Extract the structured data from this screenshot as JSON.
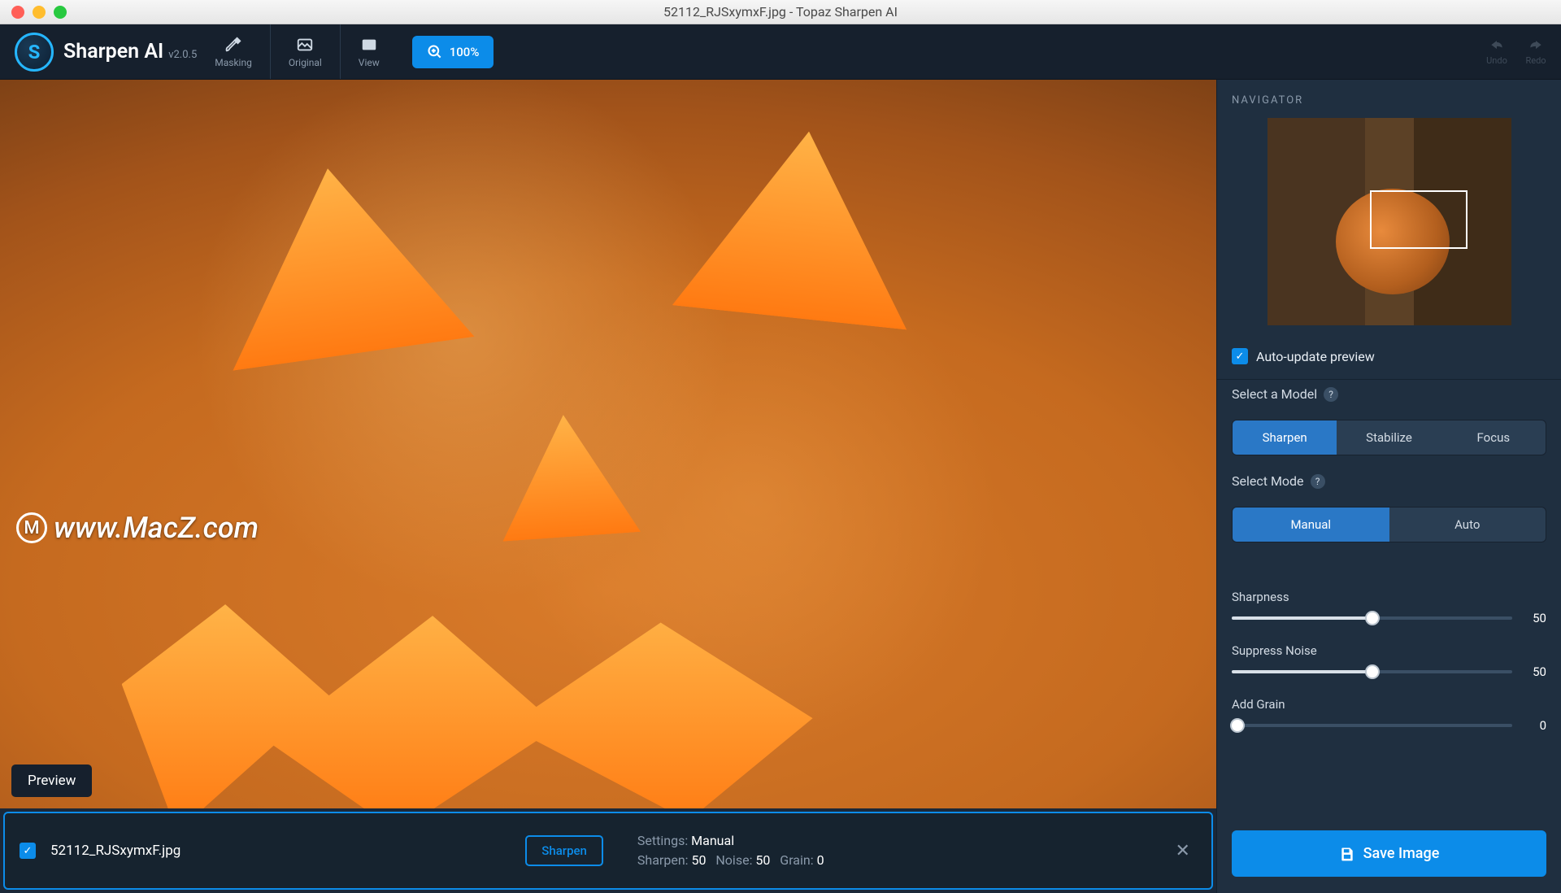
{
  "window": {
    "title": "52112_RJSxymxF.jpg - Topaz Sharpen AI"
  },
  "brand": {
    "name": "Sharpen AI",
    "version": "v2.0.5"
  },
  "toolbar": {
    "masking_label": "Masking",
    "original_label": "Original",
    "view_label": "View",
    "zoom_label": "100%",
    "undo_label": "Undo",
    "redo_label": "Redo"
  },
  "canvas": {
    "watermark": "www.MacZ.com",
    "preview_label": "Preview"
  },
  "filestrip": {
    "filename": "52112_RJSxymxF.jpg",
    "model_badge": "Sharpen",
    "settings_label": "Settings:",
    "settings_mode": "Manual",
    "sharpen_label": "Sharpen:",
    "sharpen_value": "50",
    "noise_label": "Noise:",
    "noise_value": "50",
    "grain_label": "Grain:",
    "grain_value": "0"
  },
  "right": {
    "navigator_title": "NAVIGATOR",
    "auto_update_label": "Auto-update preview",
    "select_model_label": "Select a Model",
    "models": {
      "sharpen": "Sharpen",
      "stabilize": "Stabilize",
      "focus": "Focus"
    },
    "select_mode_label": "Select Mode",
    "modes": {
      "manual": "Manual",
      "auto": "Auto"
    },
    "sliders": {
      "sharpness": {
        "label": "Sharpness",
        "value": "50",
        "percent": 50
      },
      "noise": {
        "label": "Suppress Noise",
        "value": "50",
        "percent": 50
      },
      "grain": {
        "label": "Add Grain",
        "value": "0",
        "percent": 0
      }
    },
    "save_label": "Save Image"
  }
}
